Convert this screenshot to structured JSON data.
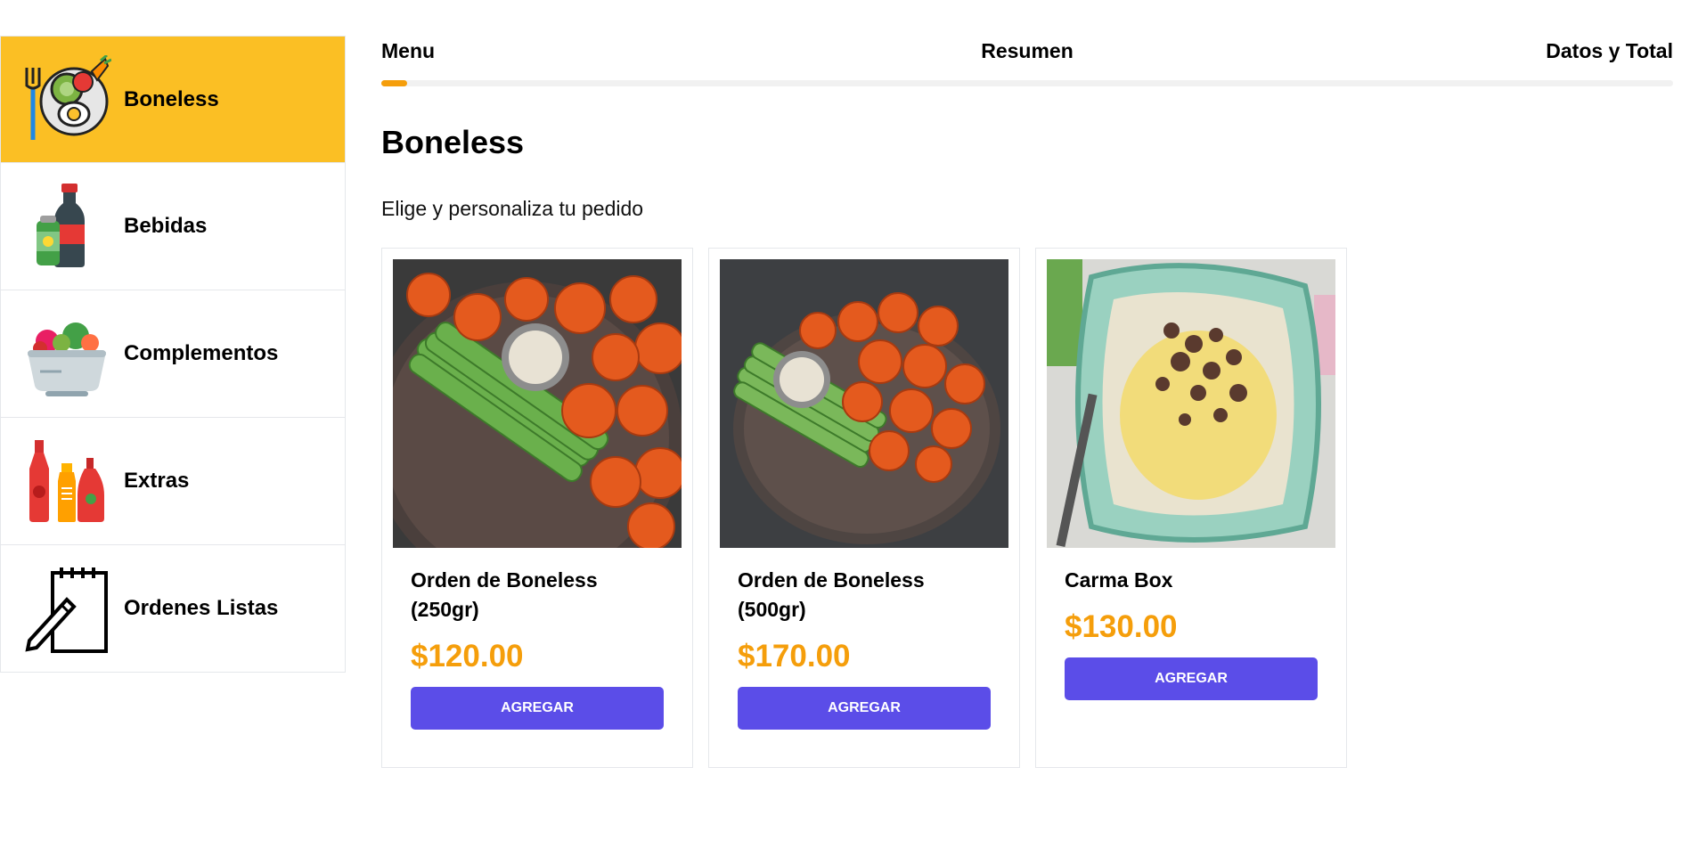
{
  "sidebar": {
    "items": [
      {
        "label": "Boneless",
        "icon": "food-plate-icon",
        "active": true
      },
      {
        "label": "Bebidas",
        "icon": "drinks-icon",
        "active": false
      },
      {
        "label": "Complementos",
        "icon": "salad-bowl-icon",
        "active": false
      },
      {
        "label": "Extras",
        "icon": "sauce-bottles-icon",
        "active": false
      },
      {
        "label": "Ordenes Listas",
        "icon": "notepad-icon",
        "active": false
      }
    ]
  },
  "steps": {
    "menu": "Menu",
    "resumen": "Resumen",
    "datos": "Datos y Total",
    "progress": 0.02
  },
  "main": {
    "title": "Boneless",
    "subtitle": "Elige y personaliza tu pedido"
  },
  "products": [
    {
      "name": "Orden de Boneless (250gr)",
      "price": "$120.00",
      "button": "Agregar",
      "image": "boneless-250-image"
    },
    {
      "name": "Orden de Boneless (500gr)",
      "price": "$170.00",
      "button": "Agregar",
      "image": "boneless-500-image"
    },
    {
      "name": "Carma Box",
      "price": "$130.00",
      "button": "Agregar",
      "image": "carma-box-image"
    }
  ],
  "colors": {
    "accent": "#fbbf24",
    "price": "#f59e0b",
    "button": "#5b4de8"
  }
}
